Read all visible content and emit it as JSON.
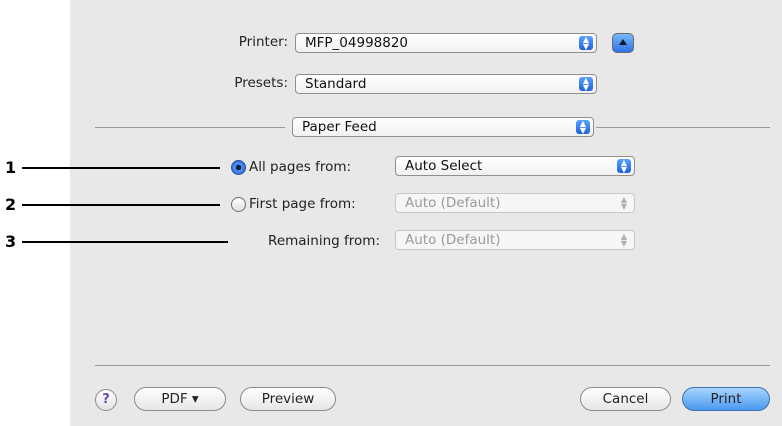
{
  "printer": {
    "label": "Printer:",
    "value": "MFP_04998820"
  },
  "presets": {
    "label": "Presets:",
    "value": "Standard"
  },
  "panel": {
    "value": "Paper Feed"
  },
  "all_pages": {
    "label": "All pages from:",
    "value": "Auto Select",
    "selected": true
  },
  "first_page": {
    "label": "First page from:",
    "value": "Auto (Default)",
    "selected": false
  },
  "remaining": {
    "label": "Remaining from:",
    "value": "Auto (Default)"
  },
  "callouts": [
    "1",
    "2",
    "3"
  ],
  "footer": {
    "help": "?",
    "pdf": "PDF ▾",
    "preview": "Preview",
    "cancel": "Cancel",
    "print": "Print"
  },
  "icons": {
    "popup_arrows": "up-down-arrows-icon",
    "eject": "eject-icon",
    "help": "help-icon"
  },
  "colors": {
    "accent": "#2d73e6",
    "default_button": "#4a98f0",
    "dialog_bg": "#e8e8e8"
  }
}
